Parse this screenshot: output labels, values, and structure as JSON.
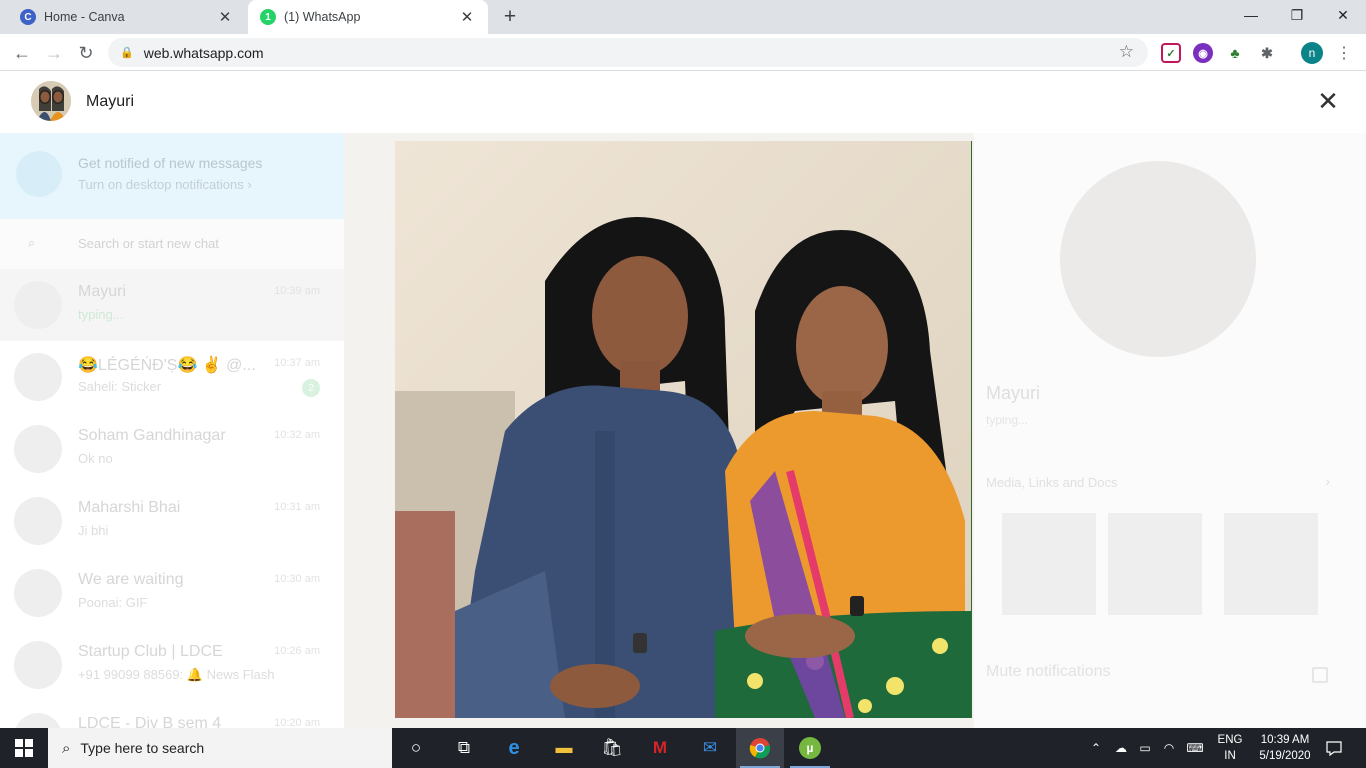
{
  "browser": {
    "tabs": [
      {
        "title": "Home - Canva",
        "favicon": "C",
        "favicon_color": "#3d63c9"
      },
      {
        "title": "(1) WhatsApp",
        "favicon": "1",
        "favicon_color": "#25d366"
      }
    ],
    "url": "web.whatsapp.com",
    "profile_initial": "n"
  },
  "viewer": {
    "contact_name": "Mayuri",
    "close_glyph": "✕"
  },
  "background": {
    "notification": {
      "title": "Get notified of new messages",
      "subtitle": "Turn on desktop notifications ›"
    },
    "search_placeholder": "Search or start new chat",
    "chats": [
      {
        "name": "Mayuri",
        "time": "10:39 am",
        "sub": "typing..."
      },
      {
        "name": "😂LÉGÉŃĐ'Ṣ😂 ✌ @...",
        "time": "10:37 am",
        "sub": "Saheli: Sticker",
        "badge": "2"
      },
      {
        "name": "Soham Gandhinagar",
        "time": "10:32 am",
        "sub": "Ok no"
      },
      {
        "name": "Maharshi Bhai",
        "time": "10:31 am",
        "sub": "Ji bhi"
      },
      {
        "name": "We are waiting",
        "time": "10:30 am",
        "sub": "Poonai: GIF"
      },
      {
        "name": "Startup Club | LDCE",
        "time": "10:26 am",
        "sub": "+91 99099 88569: 🔔 News Flash"
      },
      {
        "name": "LDCE - Div B sem 4",
        "time": "10:20 am",
        "sub": ""
      }
    ],
    "contact_info": {
      "name": "Mayuri",
      "status": "typing...",
      "media_label": "Media, Links and Docs",
      "mute_label": "Mute notifications"
    }
  },
  "taskbar": {
    "search_placeholder": "Type here to search",
    "language": "ENG",
    "region": "IN",
    "time": "10:39 AM",
    "date": "5/19/2020"
  }
}
